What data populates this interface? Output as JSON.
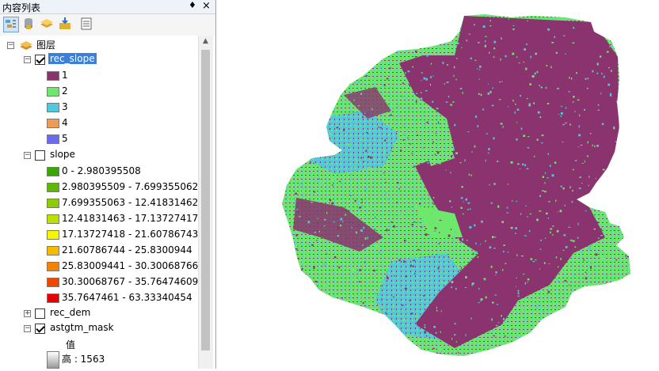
{
  "toc": {
    "title": "内容列表",
    "pin_glyph": "♦",
    "close_glyph": "×",
    "toolbar": [
      {
        "name": "list-by-drawing-order-icon"
      },
      {
        "name": "list-by-source-icon"
      },
      {
        "name": "list-by-visibility-icon"
      },
      {
        "name": "list-by-selection-icon"
      },
      {
        "name": "options-icon"
      }
    ]
  },
  "tree": {
    "root": {
      "label": "图层",
      "expanded": true
    },
    "layers": [
      {
        "name": "rec_slope",
        "checked": true,
        "expanded": true,
        "selected": true,
        "legend": [
          {
            "label": "1",
            "color": "#8a336e"
          },
          {
            "label": "2",
            "color": "#6ee86c"
          },
          {
            "label": "3",
            "color": "#4fc8e0"
          },
          {
            "label": "4",
            "color": "#f09a54"
          },
          {
            "label": "5",
            "color": "#6b6bf0"
          }
        ]
      },
      {
        "name": "slope",
        "checked": false,
        "expanded": true,
        "selected": false,
        "legend": [
          {
            "label": "0 - 2.980395508",
            "color": "#38a800"
          },
          {
            "label": "2.980395509 - 7.699355062",
            "color": "#5eb800"
          },
          {
            "label": "7.699355063 - 12.41831462",
            "color": "#8ccc00"
          },
          {
            "label": "12.41831463 - 17.13727417",
            "color": "#bde000"
          },
          {
            "label": "17.13727418 - 21.60786743",
            "color": "#f6f600"
          },
          {
            "label": "21.60786744 - 25.8300944",
            "color": "#f6ba00"
          },
          {
            "label": "25.83009441 - 30.30068766",
            "color": "#f68200"
          },
          {
            "label": "30.30068767 - 35.76474609",
            "color": "#f04600"
          },
          {
            "label": "35.7647461 - 63.33340454",
            "color": "#e60000"
          }
        ]
      },
      {
        "name": "rec_dem",
        "checked": false,
        "expanded": false,
        "selected": false,
        "legend": []
      },
      {
        "name": "astgtm_mask",
        "checked": true,
        "expanded": true,
        "selected": false,
        "value_heading": "值",
        "high_label": "高 : 1563",
        "legend": []
      }
    ]
  },
  "map": {
    "fill_color": "#8a336e",
    "speckle_colors": [
      "#6ee86c",
      "#4fc8e0",
      "#8a336e"
    ]
  }
}
